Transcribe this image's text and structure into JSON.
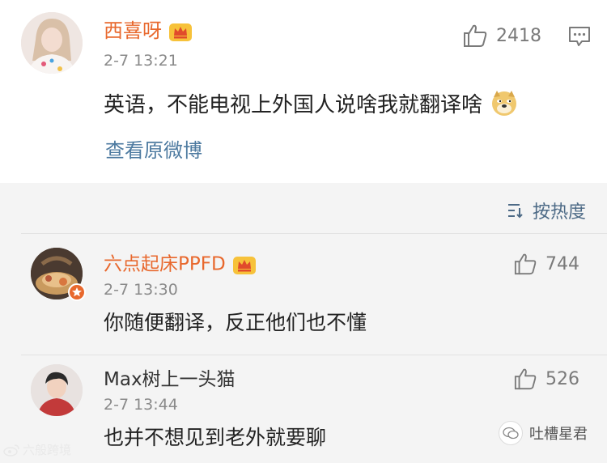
{
  "post": {
    "author": "西喜呀",
    "time": "2-7 13:21",
    "likes": "2418",
    "text": "英语，不能电视上外国人说啥我就翻译啥",
    "view_original": "查看原微博"
  },
  "sort": {
    "label": "按热度"
  },
  "comments": [
    {
      "author": "六点起床PPFD",
      "time": "2-7 13:30",
      "likes": "744",
      "text": "你随便翻译，反正他们也不懂"
    },
    {
      "author": "Max树上一头猫",
      "time": "2-7 13:44",
      "likes": "526",
      "text": "也并不想见到老外就要聊"
    }
  ],
  "watermark": {
    "left": "六般跨境",
    "right": "吐槽星君"
  },
  "colors": {
    "name_vip": "#e8682d",
    "link": "#4d7aa0",
    "muted": "#8a8a8a"
  }
}
